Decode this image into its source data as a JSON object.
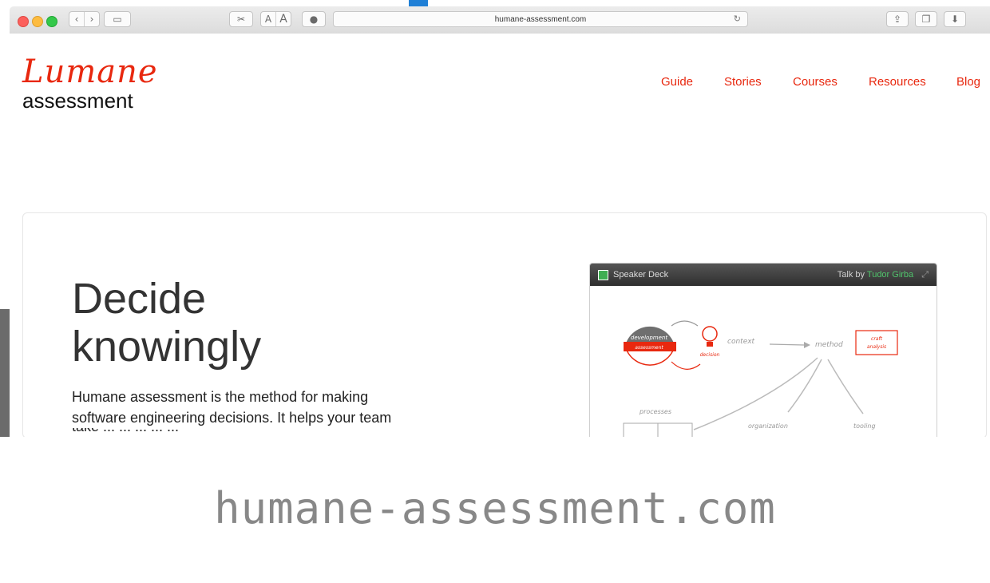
{
  "browser": {
    "url": "humane-assessment.com",
    "text_small": "A",
    "text_large": "A"
  },
  "site": {
    "logo_script": "Lumane",
    "logo_text": "assessment",
    "nav": [
      "Guide",
      "Stories",
      "Courses",
      "Resources",
      "Blog"
    ],
    "accent": "#e8280f"
  },
  "hero": {
    "title_line1": "Decide",
    "title_line2": "knowingly",
    "description": "Humane assessment is the method for making software engineering decisions. It helps your team",
    "description_partial": "take ... ... ... ... ..."
  },
  "deck": {
    "brand": "Speaker Deck",
    "talk_by": "Talk by",
    "author": "Tudor Girba",
    "labels": {
      "development": "development",
      "assessment": "assessment",
      "decision": "decision",
      "context": "context",
      "method": "method",
      "craft": "craft",
      "analysis": "analysis",
      "processes": "processes",
      "organization": "organization",
      "tooling": "tooling"
    }
  },
  "caption": "humane-assessment.com"
}
